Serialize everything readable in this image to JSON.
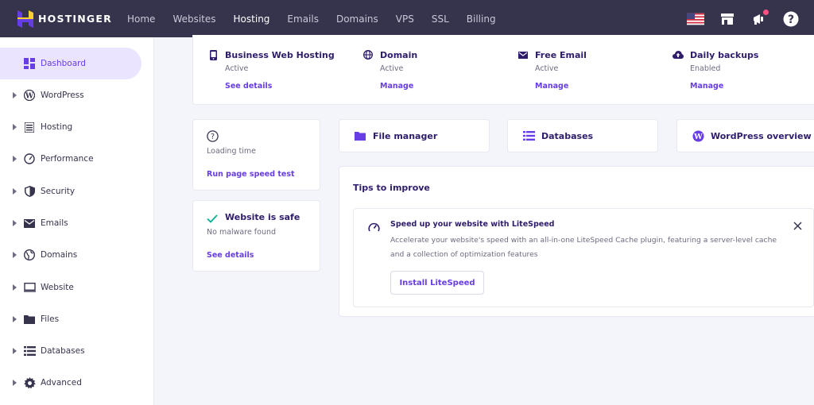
{
  "brand": {
    "name": "HOSTINGER"
  },
  "nav": [
    {
      "label": "Home",
      "active": false
    },
    {
      "label": "Websites",
      "active": false
    },
    {
      "label": "Hosting",
      "active": true
    },
    {
      "label": "Emails",
      "active": false
    },
    {
      "label": "Domains",
      "active": false
    },
    {
      "label": "VPS",
      "active": false
    },
    {
      "label": "SSL",
      "active": false
    },
    {
      "label": "Billing",
      "active": false
    }
  ],
  "top_icons": [
    "us-flag-icon",
    "store-icon",
    "megaphone-icon",
    "help-icon"
  ],
  "sidebar": {
    "items": [
      {
        "label": "Dashboard",
        "icon": "dashboard-icon",
        "active": true
      },
      {
        "label": "WordPress",
        "icon": "wordpress-icon"
      },
      {
        "label": "Hosting",
        "icon": "server-icon"
      },
      {
        "label": "Performance",
        "icon": "gauge-icon"
      },
      {
        "label": "Security",
        "icon": "shield-icon"
      },
      {
        "label": "Emails",
        "icon": "mail-icon"
      },
      {
        "label": "Domains",
        "icon": "globe-icon"
      },
      {
        "label": "Website",
        "icon": "monitor-icon"
      },
      {
        "label": "Files",
        "icon": "folder-icon"
      },
      {
        "label": "Databases",
        "icon": "database-icon"
      },
      {
        "label": "Advanced",
        "icon": "gear-icon"
      }
    ]
  },
  "services": [
    {
      "name": "Business Web Hosting",
      "status": "Active",
      "link": "See details",
      "icon": "phone-icon"
    },
    {
      "name": "Domain",
      "status": "Active",
      "link": "Manage",
      "icon": "globe-icon"
    },
    {
      "name": "Free Email",
      "status": "Active",
      "link": "Manage",
      "icon": "mail-icon"
    },
    {
      "name": "Daily backups",
      "status": "Enabled",
      "link": "Manage",
      "icon": "cloud-upload-icon"
    }
  ],
  "loading": {
    "label": "Loading time",
    "link": "Run page speed test"
  },
  "safety": {
    "title": "Website is safe",
    "sub": "No malware found",
    "link": "See details"
  },
  "quick_links": [
    {
      "label": "File manager",
      "icon": "folder-icon"
    },
    {
      "label": "Databases",
      "icon": "database-icon"
    },
    {
      "label": "WordPress overview",
      "icon": "wordpress-icon"
    }
  ],
  "tips": {
    "title": "Tips to improve",
    "item_title": "Speed up your website with LiteSpeed",
    "item_desc_1": "Accelerate your website's speed with an all-in-one LiteSpeed Cache plugin, featuring a server-level cache",
    "item_desc_2": "and a collection of optimization features",
    "button": "Install LiteSpeed"
  },
  "colors": {
    "accent": "#673de6",
    "topbar": "#36344d",
    "brand_yellow": "#ffcd35"
  }
}
